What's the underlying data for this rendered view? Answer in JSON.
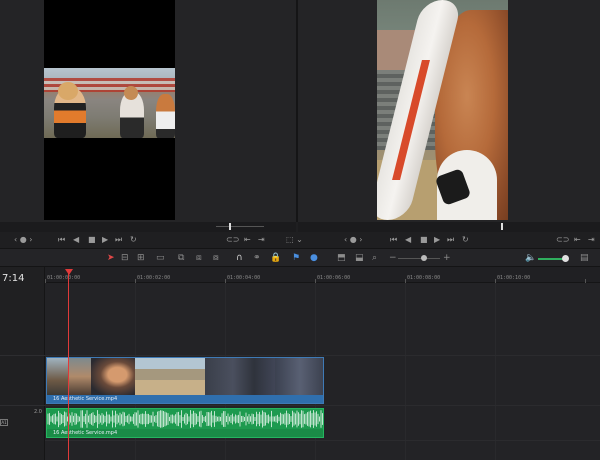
{
  "app": {
    "accent_color": "#e03a3a",
    "clip_video_color": "#2f6fae",
    "clip_audio_color": "#1d9a4f"
  },
  "viewers": {
    "source": {
      "content": "cheerleaders-photo"
    },
    "program": {
      "content": "closeup-photo"
    }
  },
  "transport": {
    "left_icons": [
      "zoom-dropdown-icon",
      "skip-start-icon",
      "step-back-icon",
      "stop-icon",
      "play-icon",
      "skip-end-icon",
      "loop-icon",
      "match-frame-icon",
      "mark-in-icon",
      "mark-out-icon"
    ],
    "right_icons": [
      "viewer-mode-icon",
      "zoom-dropdown-icon",
      "skip-start-icon",
      "step-back-icon",
      "stop-icon",
      "play-icon",
      "skip-end-icon",
      "loop-icon",
      "match-frame-icon",
      "mark-in-icon",
      "mark-out-icon"
    ]
  },
  "toolbar": {
    "tools": [
      "selection-tool-icon",
      "trim-tool-icon",
      "dynamic-trim-icon",
      "blade-tool-icon",
      "insert-clip-icon",
      "overwrite-clip-icon",
      "replace-clip-icon",
      "snapping-icon",
      "linked-selection-icon",
      "lock-icon",
      "flag-icon",
      "marker-icon",
      "zoom-full-icon",
      "zoom-detail-icon",
      "zoom-custom-icon",
      "zoom-out-icon",
      "zoom-in-icon",
      "volume-icon",
      "mixer-icon"
    ]
  },
  "timeline": {
    "timecode": "7:14",
    "ruler_labels": [
      "01:00:00:00",
      "01:00:02:00",
      "01:00:04:00",
      "01:00:06:00",
      "01:00:08:00",
      "01:00:10:00"
    ],
    "track_tags": {
      "audio_level": "2.0",
      "audio_box": "A1"
    },
    "video_clip": {
      "name": "16 Aesthetic Service.mp4"
    },
    "audio_clip": {
      "name": "16 Aesthetic Service.mp4"
    }
  }
}
